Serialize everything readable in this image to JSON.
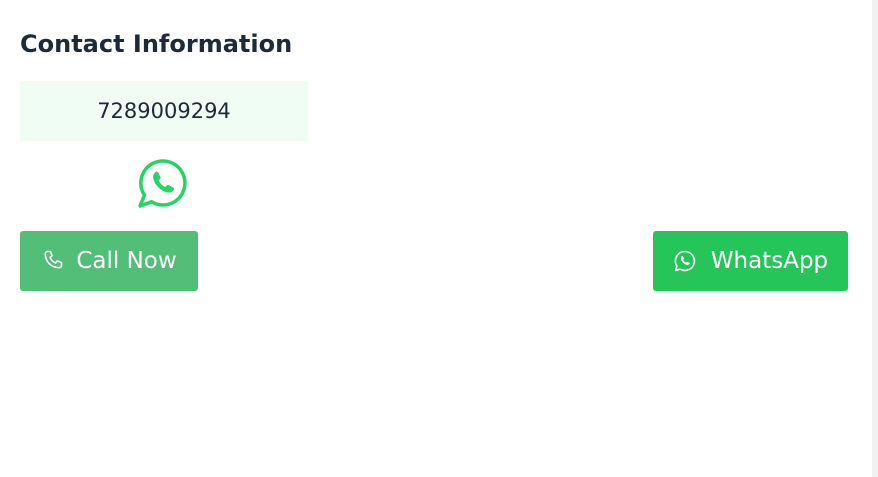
{
  "contact": {
    "title": "Contact Information",
    "phone": "7289009294"
  },
  "actions": {
    "call_label": "Call Now",
    "whatsapp_label": "WhatsApp"
  },
  "icons": {
    "logo": "whatsapp-icon",
    "call": "phone-icon",
    "whatsapp": "whatsapp-icon"
  },
  "colors": {
    "call_button": "#52be78",
    "whatsapp_button": "#25c55a",
    "phone_box_bg": "#f0fdf4",
    "whatsapp_logo": "#25d366"
  }
}
